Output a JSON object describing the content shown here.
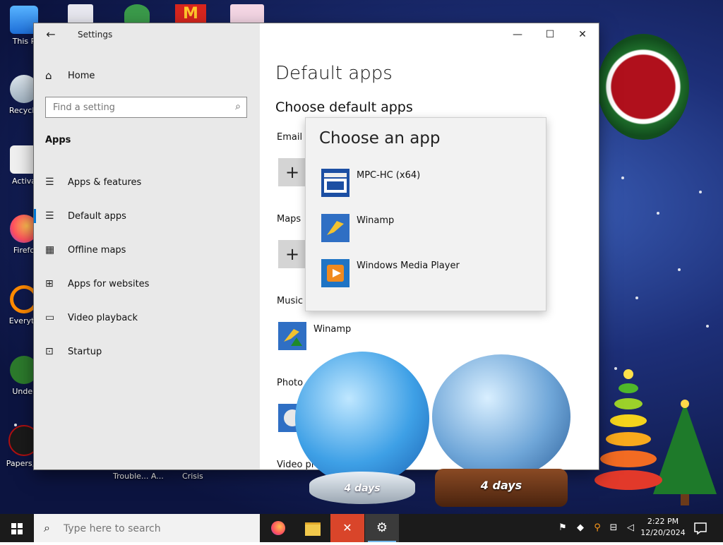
{
  "desktop": {
    "icons": [
      {
        "label": "This P",
        "name": "this-pc"
      },
      {
        "label": "Recycle",
        "name": "recycle-bin"
      },
      {
        "label": "Activa",
        "name": "activate"
      },
      {
        "label": "Firefo",
        "name": "firefox"
      },
      {
        "label": "Everyth",
        "name": "everything"
      },
      {
        "label": "Under",
        "name": "undertale"
      },
      {
        "label": "Papers, P",
        "name": "papers-please"
      }
    ],
    "bottom_labels": [
      "Trouble... A...",
      "Crisis"
    ],
    "globe_labels": [
      "4 days",
      "4 days"
    ]
  },
  "window": {
    "title": "Settings",
    "home": "Home",
    "search_placeholder": "Find a setting",
    "section": "Apps",
    "nav": [
      {
        "label": "Apps & features",
        "icon": "list-icon"
      },
      {
        "label": "Default apps",
        "icon": "default-apps-icon"
      },
      {
        "label": "Offline maps",
        "icon": "map-icon"
      },
      {
        "label": "Apps for websites",
        "icon": "link-icon"
      },
      {
        "label": "Video playback",
        "icon": "video-icon"
      },
      {
        "label": "Startup",
        "icon": "startup-icon"
      }
    ],
    "page_title": "Default apps",
    "sub_title": "Choose default apps",
    "categories": {
      "email": "Email",
      "maps": "Maps",
      "music": "Music",
      "music_app": "Winamp",
      "photo": "Photo",
      "video": "Video pl"
    }
  },
  "flyout": {
    "title": "Choose an app",
    "apps": [
      "MPC-HC (x64)",
      "Winamp",
      "Windows Media Player"
    ]
  },
  "taskbar": {
    "search_placeholder": "Type here to search",
    "time": "2:22 PM",
    "date": "12/20/2024"
  }
}
